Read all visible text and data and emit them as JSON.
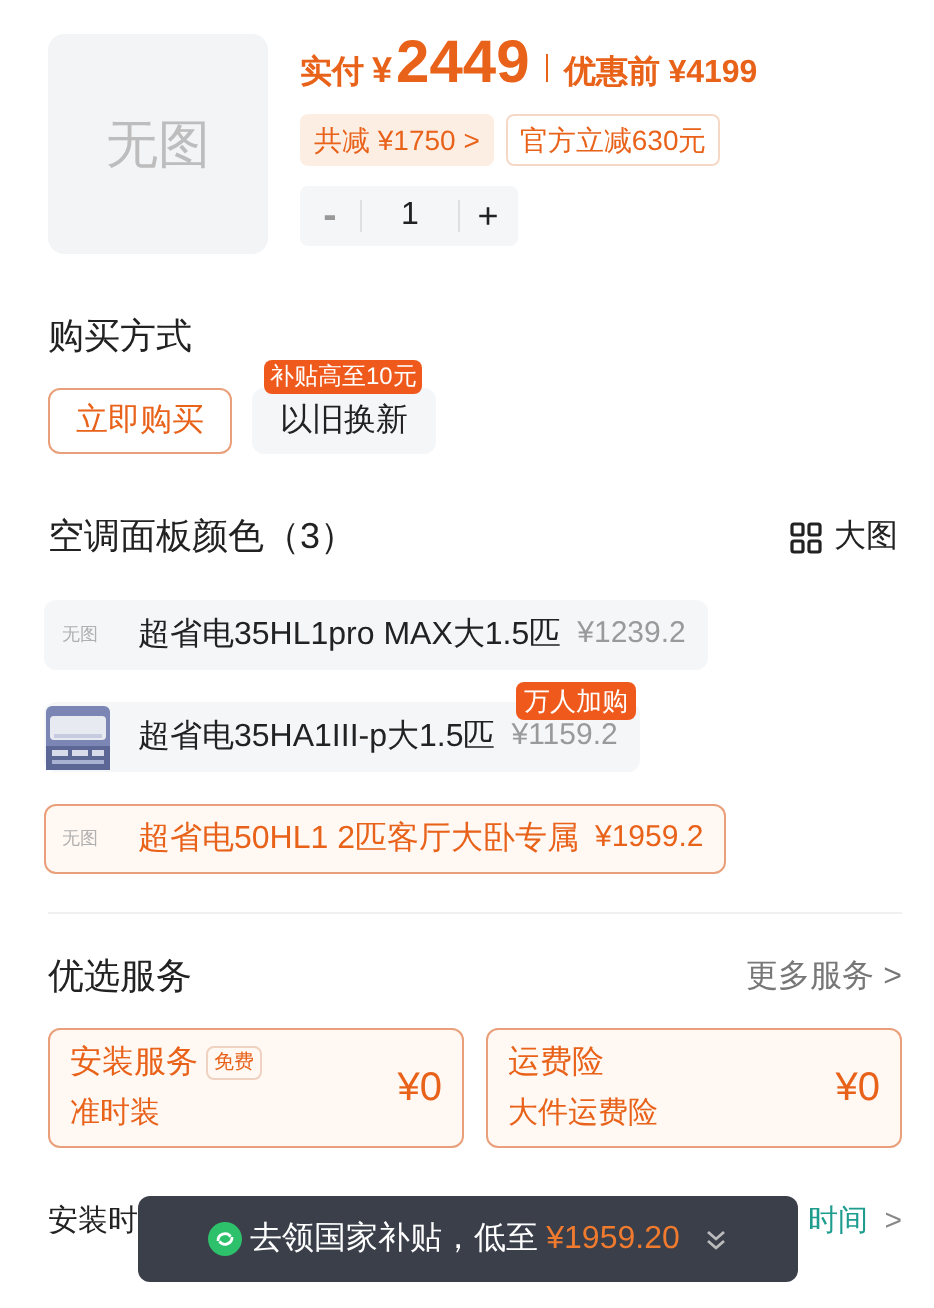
{
  "product": {
    "thumbnail": "无图",
    "paid_label": "实付",
    "paid_currency": "¥",
    "paid_amount": "2449",
    "original_label": "优惠前 ¥4199",
    "discount_chip": "共减 ¥1750 >",
    "official_chip": "官方立减630元",
    "quantity": {
      "minus": "-",
      "value": "1",
      "plus": "+",
      "minus_disabled": true
    }
  },
  "purchase_method": {
    "title": "购买方式",
    "options": [
      {
        "label": "立即购买",
        "selected": true
      },
      {
        "label": "以旧换新",
        "selected": false,
        "badge": "补贴高至10元"
      }
    ]
  },
  "variants": {
    "title": "空调面板颜色（3）",
    "view_toggle": "大图",
    "items": [
      {
        "name": "超省电35HL1pro MAX大1.5匹",
        "price": "¥1239.2",
        "kind": "placeholder",
        "thumb_text": "无图",
        "selected": false
      },
      {
        "name": "超省电35HA1III-p大1.5匹",
        "price": "¥1159.2",
        "kind": "picture",
        "badge": "万人加购",
        "selected": false
      },
      {
        "name": "超省电50HL1 2匹客厅大卧专属",
        "price": "¥1959.2",
        "kind": "placeholder",
        "thumb_text": "无图",
        "selected": true
      }
    ]
  },
  "services": {
    "title": "优选服务",
    "more": "更多服务 >",
    "cards": [
      {
        "title": "安装服务",
        "tag": "免费",
        "subtitle": "准时装",
        "price": "¥0",
        "selected": true
      },
      {
        "title": "运费险",
        "subtitle": "大件运费险",
        "price": "¥0",
        "selected": true
      }
    ]
  },
  "install_time": {
    "label": "安装时",
    "value": "时间",
    "chevron": ">"
  },
  "toast": {
    "text": "去领国家补贴，低至",
    "price": "¥1959.20"
  }
}
